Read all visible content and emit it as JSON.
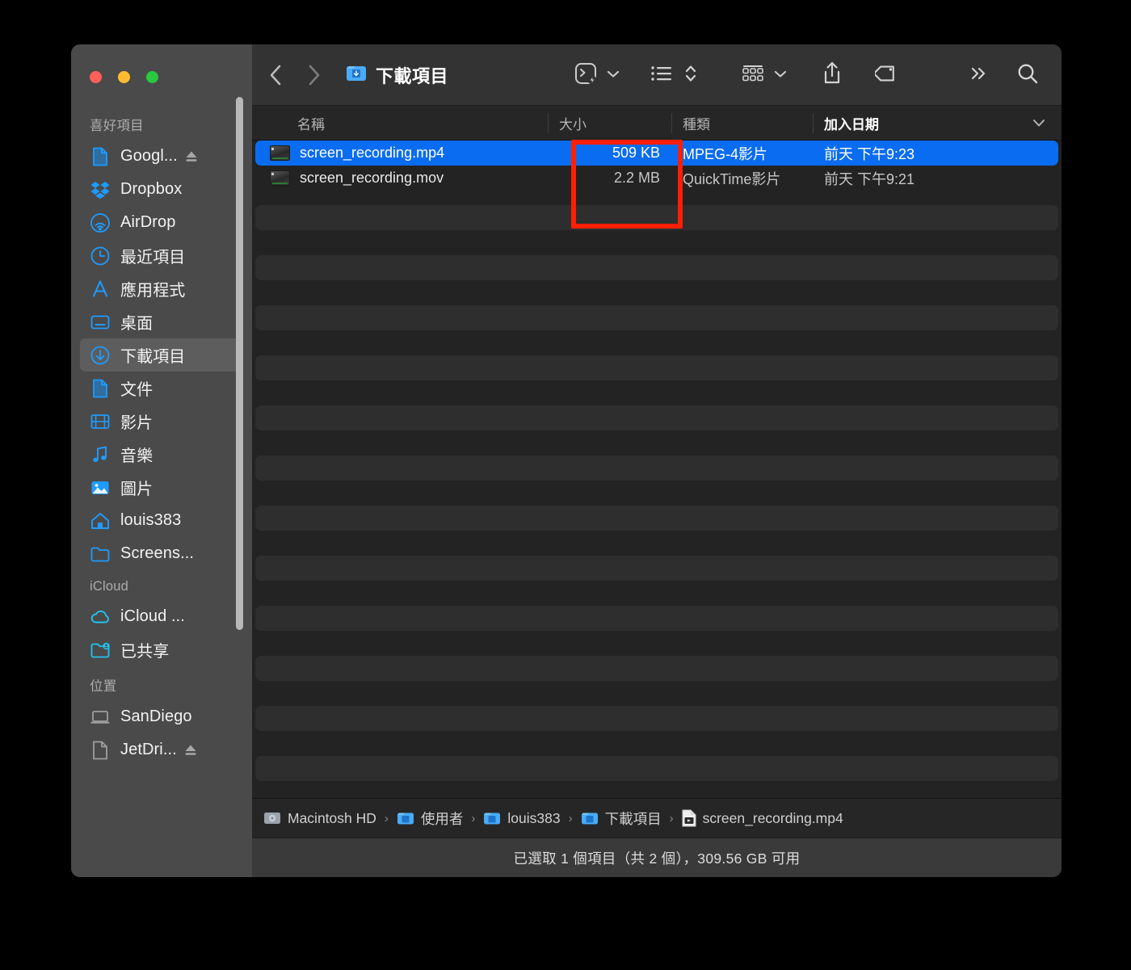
{
  "window": {
    "traffic_lights": [
      {
        "name": "close",
        "color": "#ff5f57"
      },
      {
        "name": "minimize",
        "color": "#febc2e"
      },
      {
        "name": "zoom",
        "color": "#28c840"
      }
    ]
  },
  "toolbar": {
    "back_label": "‹",
    "forward_label": "›",
    "title": "下載項目",
    "folder_icon": "downloads-folder-icon",
    "icons": [
      "quick-actions-icon",
      "chevron-down-icon",
      "list-view-icon",
      "sort-updown-icon",
      "group-by-icon",
      "chevron-down-icon",
      "share-icon",
      "tag-icon",
      "more-chevrons-icon",
      "search-icon"
    ]
  },
  "sidebar": {
    "scrollbar": "visible",
    "sections": [
      {
        "title": "喜好項目",
        "items": [
          {
            "label": "Googl...",
            "icon": "document-icon",
            "eject": true,
            "selected": false
          },
          {
            "label": "Dropbox",
            "icon": "dropbox-icon",
            "eject": false,
            "selected": false
          },
          {
            "label": "AirDrop",
            "icon": "airdrop-icon",
            "eject": false,
            "selected": false
          },
          {
            "label": "最近項目",
            "icon": "clock-icon",
            "eject": false,
            "selected": false
          },
          {
            "label": "應用程式",
            "icon": "applications-icon",
            "eject": false,
            "selected": false
          },
          {
            "label": "桌面",
            "icon": "desktop-icon",
            "eject": false,
            "selected": false
          },
          {
            "label": "下載項目",
            "icon": "downloads-icon",
            "eject": false,
            "selected": true
          },
          {
            "label": "文件",
            "icon": "document-icon",
            "eject": false,
            "selected": false
          },
          {
            "label": "影片",
            "icon": "movies-icon",
            "eject": false,
            "selected": false
          },
          {
            "label": "音樂",
            "icon": "music-icon",
            "eject": false,
            "selected": false
          },
          {
            "label": "圖片",
            "icon": "pictures-icon",
            "eject": false,
            "selected": false
          },
          {
            "label": "louis383",
            "icon": "home-icon",
            "eject": false,
            "selected": false
          },
          {
            "label": "Screens...",
            "icon": "folder-icon",
            "eject": false,
            "selected": false
          }
        ]
      },
      {
        "title": "iCloud",
        "items": [
          {
            "label": "iCloud ...",
            "icon": "icloud-icon",
            "eject": false,
            "selected": false
          },
          {
            "label": "已共享",
            "icon": "shared-folder-icon",
            "eject": false,
            "selected": false
          }
        ]
      },
      {
        "title": "位置",
        "items": [
          {
            "label": "SanDiego",
            "icon": "laptop-icon",
            "eject": false,
            "selected": false
          },
          {
            "label": "JetDri...",
            "icon": "disk-icon",
            "eject": true,
            "selected": false
          }
        ]
      }
    ]
  },
  "columns": [
    {
      "id": "name",
      "label": "名稱",
      "active": false
    },
    {
      "id": "size",
      "label": "大小",
      "active": false
    },
    {
      "id": "kind",
      "label": "種類",
      "active": false
    },
    {
      "id": "date",
      "label": "加入日期",
      "active": true
    }
  ],
  "files": [
    {
      "name": "screen_recording.mp4",
      "size": "509 KB",
      "kind": "MPEG-4影片",
      "date": "前天 下午9:23",
      "selected": true,
      "icon": "video-file-icon"
    },
    {
      "name": "screen_recording.mov",
      "size": "2.2 MB",
      "kind": "QuickTime影片",
      "date": "前天 下午9:21",
      "selected": false,
      "icon": "video-file-icon"
    }
  ],
  "path_bar": {
    "crumbs": [
      {
        "label": "Macintosh HD",
        "icon": "hard-disk-icon"
      },
      {
        "label": "使用者",
        "icon": "users-folder-icon"
      },
      {
        "label": "louis383",
        "icon": "home-folder-icon"
      },
      {
        "label": "下載項目",
        "icon": "downloads-folder-icon"
      },
      {
        "label": "screen_recording.mp4",
        "icon": "video-file-icon"
      }
    ],
    "separator": "›"
  },
  "status_bar": {
    "text": "已選取 1 個項目（共 2 個），309.56 GB 可用"
  },
  "annotation": {
    "shape": "rectangle",
    "color": "#ff1f05",
    "target": "size-column-values"
  },
  "colors": {
    "selection_blue": "#0a6cf0",
    "sidebar_bg": "#4a4a4a",
    "content_bg": "#232323",
    "accent_icon": "#1f9bff"
  }
}
